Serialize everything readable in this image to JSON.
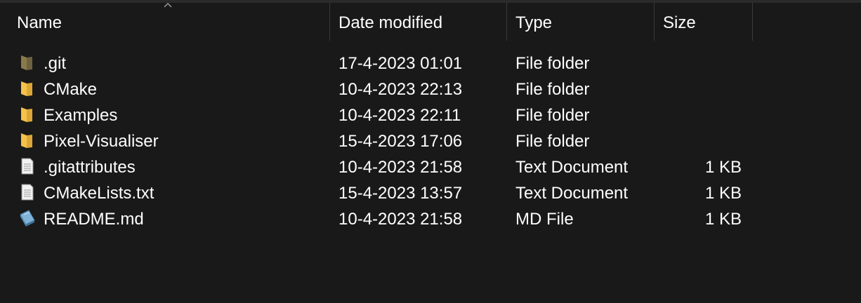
{
  "columns": {
    "name": "Name",
    "date": "Date modified",
    "type": "Type",
    "size": "Size"
  },
  "sort": {
    "column": "name",
    "direction": "ascending",
    "icon": "sort-up-icon"
  },
  "files": [
    {
      "name": ".git",
      "date": "17-4-2023 01:01",
      "type": "File folder",
      "size": "",
      "icon": "folder-hidden-icon"
    },
    {
      "name": "CMake",
      "date": "10-4-2023 22:13",
      "type": "File folder",
      "size": "",
      "icon": "folder-icon"
    },
    {
      "name": "Examples",
      "date": "10-4-2023 22:11",
      "type": "File folder",
      "size": "",
      "icon": "folder-icon"
    },
    {
      "name": "Pixel-Visualiser",
      "date": "15-4-2023 17:06",
      "type": "File folder",
      "size": "",
      "icon": "folder-icon"
    },
    {
      "name": ".gitattributes",
      "date": "10-4-2023 21:58",
      "type": "Text Document",
      "size": "1 KB",
      "icon": "text-document-icon"
    },
    {
      "name": "CMakeLists.txt",
      "date": "15-4-2023 13:57",
      "type": "Text Document",
      "size": "1 KB",
      "icon": "text-document-icon"
    },
    {
      "name": "README.md",
      "date": "10-4-2023 21:58",
      "type": "MD File",
      "size": "1 KB",
      "icon": "md-file-icon"
    }
  ],
  "colors": {
    "background": "#191919",
    "text": "#ffffff",
    "folder": "#f4c24b",
    "folder_hidden": "#8a7a4a"
  }
}
